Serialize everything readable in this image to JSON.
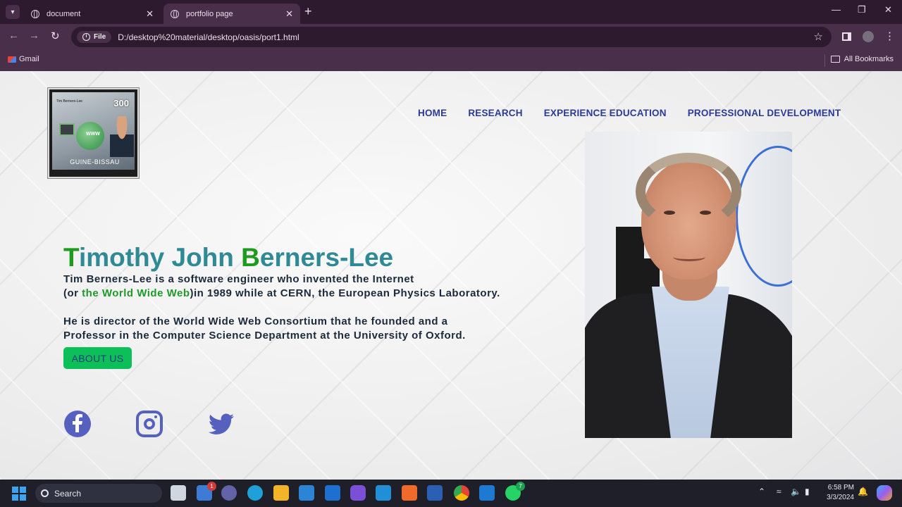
{
  "browser": {
    "tabs": [
      {
        "title": "document",
        "active": false
      },
      {
        "title": "portfolio page",
        "active": true
      }
    ],
    "address": {
      "scheme_chip": "File",
      "url": "D:/desktop%20material/desktop/oasis/port1.html"
    },
    "bookmarks": {
      "gmail": "Gmail",
      "all_bookmarks": "All Bookmarks"
    }
  },
  "page": {
    "logo_stamp": {
      "name": "Tim Berners-Lee",
      "value": "300",
      "www": "WWW",
      "country": "GUINE-BISSAU"
    },
    "nav": [
      "HOME",
      "RESEARCH",
      "EXPERIENCE EDUCATION",
      "PROFESSIONAL DEVELOPMENT"
    ],
    "headline": {
      "initial_1": "T",
      "part_1": "imothy John ",
      "initial_2": "B",
      "part_2": "erners-Lee"
    },
    "bio": {
      "line1": "Tim Berners-Lee is a software engineer who invented the Internet",
      "line2_pre": "(or ",
      "line2_link": "the World Wide Web",
      "line2_post": ")in 1989 while at CERN, the European Physics Laboratory.",
      "line3": "He is director of the World Wide Web Consortium that he founded and a",
      "line4": "Professor in the Computer Science Department at the University of Oxford."
    },
    "about_button": "ABOUT US",
    "social": [
      "facebook-icon",
      "instagram-icon",
      "twitter-icon"
    ],
    "colors": {
      "headline_teal": "#2f8a96",
      "headline_initial_green": "#1e9a1e",
      "nav_blue": "#2a3a9a",
      "button_green": "#0cbf58",
      "social_purple": "#5660be"
    }
  },
  "taskbar": {
    "search_label": "Search",
    "badges": {
      "teams": "1",
      "whatsapp": "7"
    },
    "time": "6:58 PM",
    "date": "3/3/2024"
  }
}
